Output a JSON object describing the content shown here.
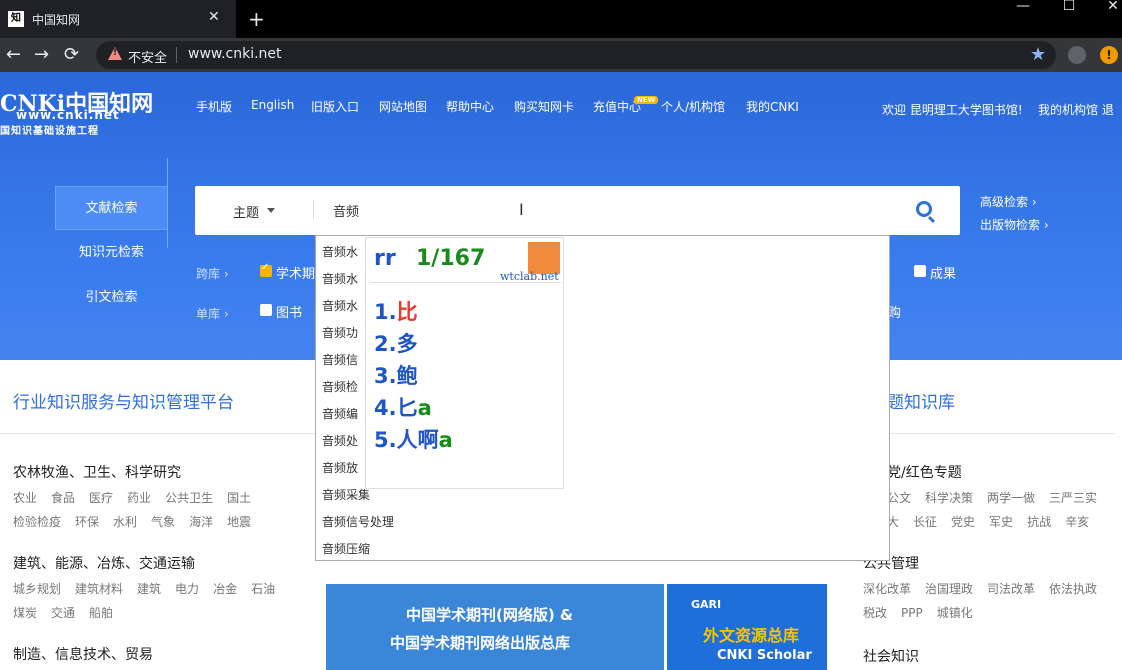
{
  "browser": {
    "tab_title": "中国知网",
    "tab_icon": "知",
    "close": "✕",
    "new_tab": "+",
    "insecure_label": "不安全",
    "url": "www.cnki.net"
  },
  "site": {
    "logo_main": "CNKi中国知网",
    "logo_url": "www.cnki.net",
    "logo_sub": "国知识基础设施工程",
    "nav": [
      "手机版",
      "English",
      "旧版入口",
      "网站地图",
      "帮助中心",
      "购买知网卡",
      "充值中心",
      "个人/机构馆",
      "我的CNKI"
    ],
    "new_badge": "NEW",
    "welcome": "欢迎 昆明理工大学图书馆!",
    "my_org": "我的机构馆 退"
  },
  "side_tabs": [
    "文献检索",
    "知识元检索",
    "引文检索"
  ],
  "search": {
    "type_label": "主题",
    "query": "音频",
    "advanced": "高级检索 ›",
    "publication": "出版物检索 ›"
  },
  "filters": {
    "cross_label": "跨库 ›",
    "single_label": "单库 ›",
    "cross_first": "学术期",
    "cross_last": "成果",
    "single_first": "图书",
    "single_last": "购"
  },
  "suggestions": [
    "音频水",
    "音频水",
    "音频水",
    "音频功",
    "音频信",
    "音频检",
    "音频编",
    "音频处",
    "音频放",
    "音频采集",
    "音频信号处理",
    "音频压缩"
  ],
  "ime": {
    "code": "rr",
    "page": "1/167",
    "site": "wtclab.net",
    "candidates": [
      {
        "num": "1.",
        "text": "比",
        "suffix": ""
      },
      {
        "num": "2.",
        "text": "多",
        "suffix": ""
      },
      {
        "num": "3.",
        "text": "鲍",
        "suffix": ""
      },
      {
        "num": "4.",
        "text": "匕",
        "suffix": "a"
      },
      {
        "num": "5.",
        "text": "人啊",
        "suffix": "a"
      }
    ]
  },
  "sections": {
    "left_title": "行业知识服务与知识管理平台",
    "right_title": "题知识库"
  },
  "categories_left": [
    {
      "title": "农林牧渔、卫生、科学研究",
      "items": [
        "农业",
        "食品",
        "医疗",
        "药业",
        "公共卫生",
        "国土"
      ],
      "items2": [
        "检验检疫",
        "环保",
        "水利",
        "气象",
        "海洋",
        "地震"
      ]
    },
    {
      "title": "建筑、能源、冶炼、交通运输",
      "items": [
        "城乡规划",
        "建筑材料",
        "建筑",
        "电力",
        "冶金",
        "石油"
      ],
      "items2": [
        "煤炭",
        "交通",
        "船舶"
      ]
    },
    {
      "title": "制造、信息技术、贸易",
      "items": [],
      "items2": []
    }
  ],
  "categories_right": [
    {
      "title": "党/红色专题",
      "items": [
        "公文",
        "科学决策",
        "两学一做",
        "三严三实"
      ],
      "items2": [
        "大",
        "长征",
        "党史",
        "军史",
        "抗战",
        "辛亥"
      ]
    },
    {
      "title": "公共管理",
      "items": [
        "深化改革",
        "治国理政",
        "司法改革",
        "依法执政"
      ],
      "items2": [
        "税改",
        "PPP",
        "城镇化"
      ]
    },
    {
      "title": "社会知识",
      "items": [],
      "items2": []
    }
  ],
  "banners": {
    "left_line1": "中国学术期刊(网络版) &",
    "left_line2": "中国学术期刊网络出版总库",
    "gari": "GARI",
    "waiwen": "外文资源总库",
    "scholar": "CNKI Scholar"
  }
}
